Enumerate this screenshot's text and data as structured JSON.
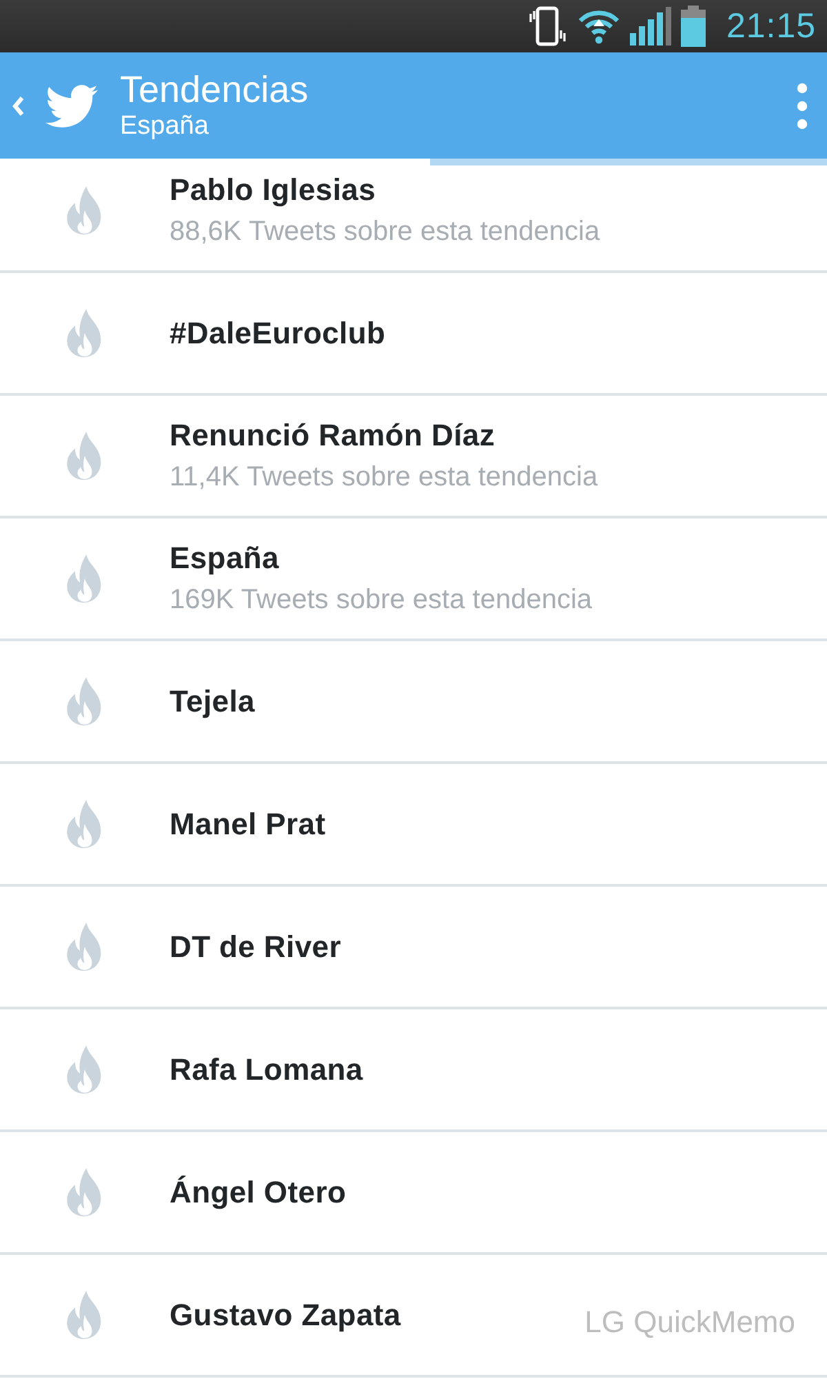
{
  "status_bar": {
    "time": "21:15"
  },
  "action_bar": {
    "title": "Tendencias",
    "subtitle": "España"
  },
  "tab_indicator": {
    "level": 0.52
  },
  "trends": [
    {
      "name": "Pablo Iglesias",
      "tweet_count": "88,6K Tweets sobre esta tendencia"
    },
    {
      "name": "#DaleEuroclub"
    },
    {
      "name": "Renunció Ramón Díaz",
      "tweet_count": "11,4K Tweets sobre esta tendencia"
    },
    {
      "name": "España",
      "tweet_count": "169K Tweets sobre esta tendencia"
    },
    {
      "name": "Tejela"
    },
    {
      "name": "Manel Prat"
    },
    {
      "name": "DT de River"
    },
    {
      "name": "Rafa Lomana"
    },
    {
      "name": "Ángel Otero"
    },
    {
      "name": "Gustavo Zapata"
    }
  ],
  "overlay_label": "LG QuickMemo"
}
